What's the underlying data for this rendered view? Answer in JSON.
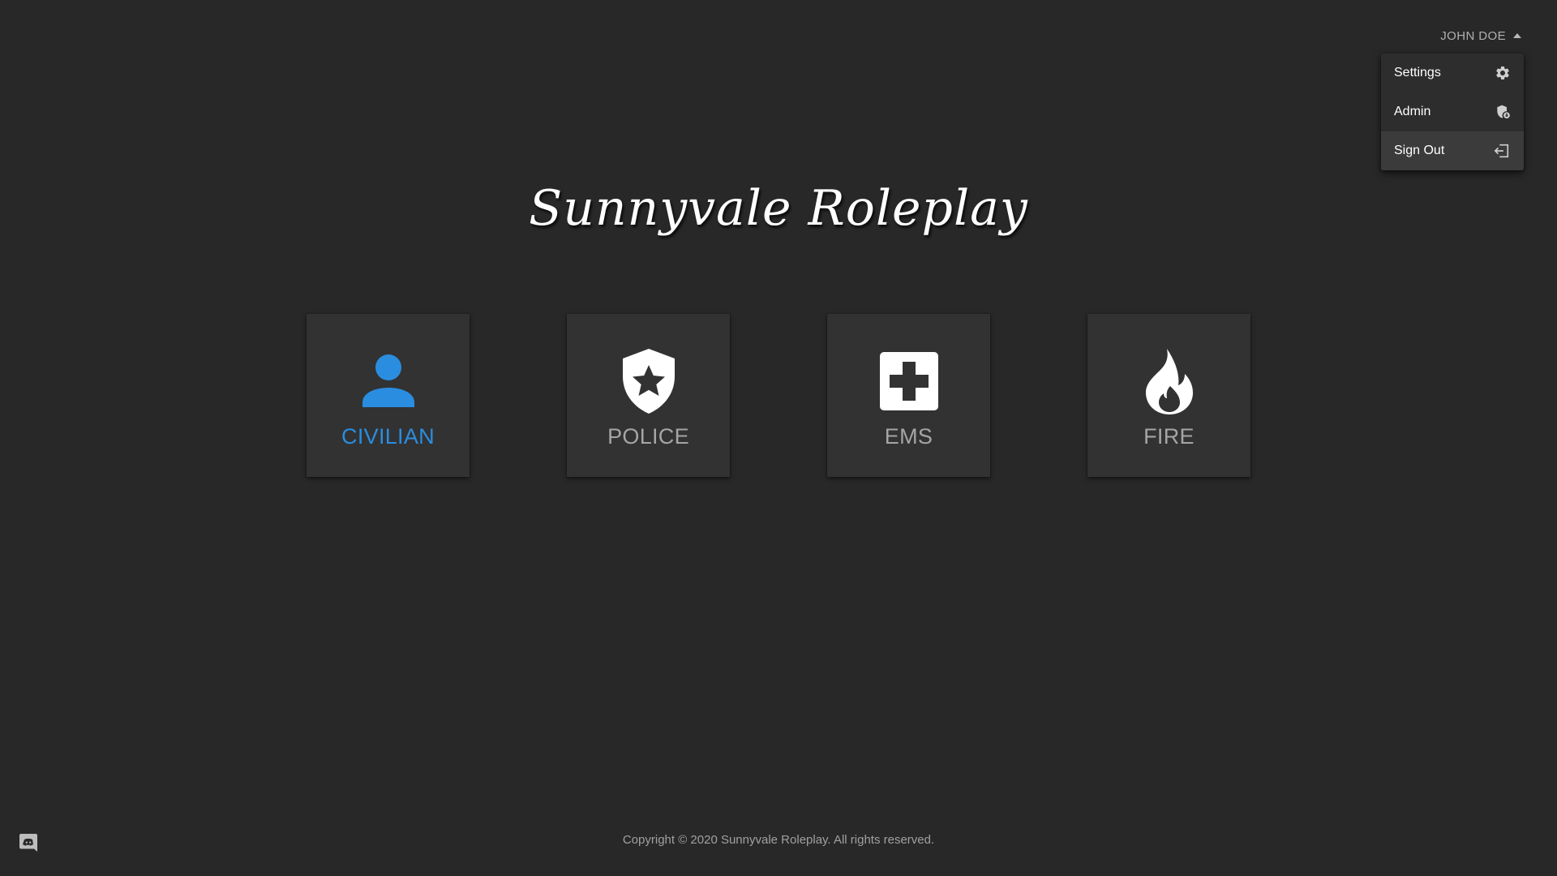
{
  "user": {
    "name": "JOHN DOE"
  },
  "menu": {
    "items": [
      {
        "label": "Settings",
        "icon": "gear-icon"
      },
      {
        "label": "Admin",
        "icon": "shield-lock-icon"
      },
      {
        "label": "Sign Out",
        "icon": "sign-out-icon"
      }
    ],
    "active_item": "Sign Out"
  },
  "brand": {
    "title": "Sunnyvale Roleplay"
  },
  "departments": [
    {
      "label": "CIVILIAN",
      "icon": "person-icon",
      "selected": true
    },
    {
      "label": "POLICE",
      "icon": "police-shield-star-icon",
      "selected": false
    },
    {
      "label": "EMS",
      "icon": "medical-cross-icon",
      "selected": false
    },
    {
      "label": "FIRE",
      "icon": "flame-icon",
      "selected": false
    }
  ],
  "footer": {
    "copyright": "Copyright © 2020 Sunnyvale Roleplay. All rights reserved."
  },
  "colors": {
    "background": "#282828",
    "card": "#323232",
    "accent": "#2a8de0",
    "muted": "#a5a5a5"
  },
  "icons": {
    "discord": "discord-icon",
    "caret": "caret-up-icon"
  }
}
